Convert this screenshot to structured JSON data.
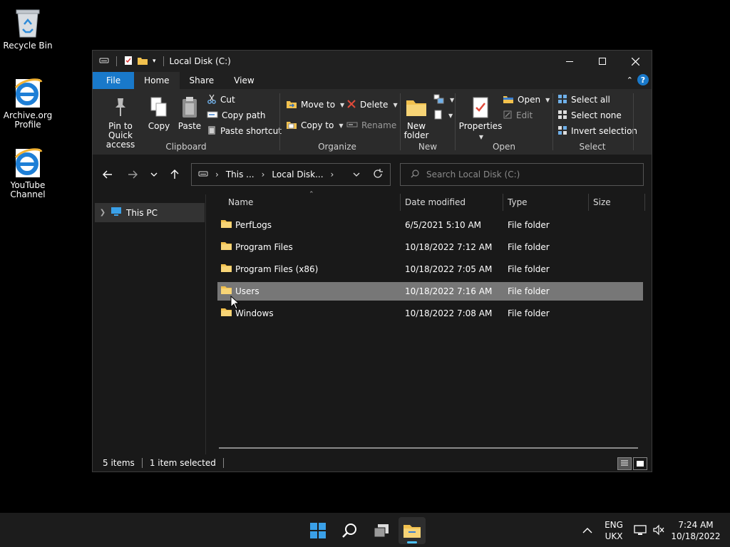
{
  "desktop": {
    "icons": [
      {
        "label": "Recycle Bin",
        "icon": "recycle-bin-icon"
      },
      {
        "label": "Archive.org Profile",
        "icon": "internet-explorer-icon"
      },
      {
        "label": "YouTube Channel",
        "icon": "internet-explorer-icon"
      }
    ]
  },
  "window": {
    "title": "Local Disk (C:)",
    "tabs": {
      "file": "File",
      "home": "Home",
      "share": "Share",
      "view": "View"
    },
    "ribbon": {
      "clipboard": {
        "pin": "Pin to Quick access",
        "copy": "Copy",
        "paste": "Paste",
        "cut": "Cut",
        "copy_path": "Copy path",
        "paste_shortcut": "Paste shortcut",
        "label": "Clipboard"
      },
      "organize": {
        "move_to": "Move to",
        "copy_to": "Copy to",
        "delete": "Delete",
        "rename": "Rename",
        "label": "Organize"
      },
      "new": {
        "new_folder": "New folder",
        "label": "New"
      },
      "open": {
        "properties": "Properties",
        "open": "Open",
        "edit": "Edit",
        "label": "Open"
      },
      "select": {
        "select_all": "Select all",
        "select_none": "Select none",
        "invert": "Invert selection",
        "label": "Select"
      }
    },
    "address": {
      "crumb1": "This ...",
      "crumb2": "Local Disk..."
    },
    "search_placeholder": "Search Local Disk (C:)",
    "navpane": {
      "this_pc": "This PC"
    },
    "columns": {
      "name": "Name",
      "date": "Date modified",
      "type": "Type",
      "size": "Size"
    },
    "files": [
      {
        "name": "PerfLogs",
        "date": "6/5/2021 5:10 AM",
        "type": "File folder"
      },
      {
        "name": "Program Files",
        "date": "10/18/2022 7:12 AM",
        "type": "File folder"
      },
      {
        "name": "Program Files (x86)",
        "date": "10/18/2022 7:05 AM",
        "type": "File folder"
      },
      {
        "name": "Users",
        "date": "10/18/2022 7:16 AM",
        "type": "File folder"
      },
      {
        "name": "Windows",
        "date": "10/18/2022 7:08 AM",
        "type": "File folder"
      }
    ],
    "status": {
      "items": "5 items",
      "selected": "1 item selected"
    }
  },
  "taskbar": {
    "lang1": "ENG",
    "lang2": "UKX",
    "time": "7:24 AM",
    "date": "10/18/2022"
  },
  "colors": {
    "accent": "#1979ca",
    "selected_row": "#777777",
    "folder": "#f2c14e"
  }
}
